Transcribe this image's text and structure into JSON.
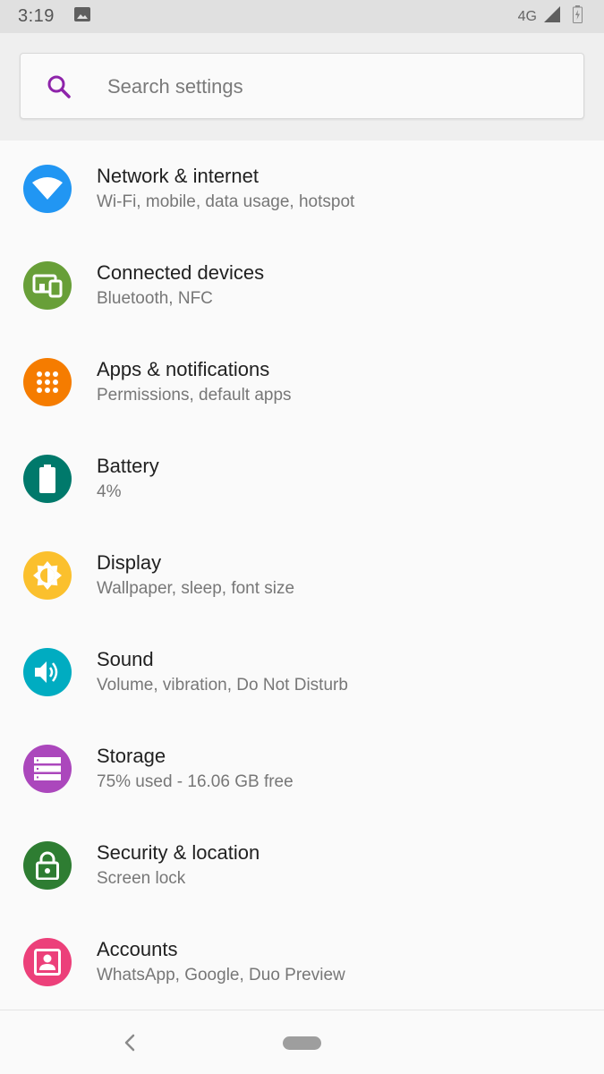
{
  "status_bar": {
    "time": "3:19",
    "network": "4G",
    "icons": [
      "image-icon",
      "signal-icon",
      "battery-icon"
    ]
  },
  "search": {
    "placeholder": "Search settings",
    "icon": "search-icon",
    "icon_color": "#8e24aa"
  },
  "settings": [
    {
      "title": "Network & internet",
      "subtitle": "Wi-Fi, mobile, data usage, hotspot",
      "icon": "wifi-icon",
      "color": "#2196f3"
    },
    {
      "title": "Connected devices",
      "subtitle": "Bluetooth, NFC",
      "icon": "devices-icon",
      "color": "#689f38"
    },
    {
      "title": "Apps & notifications",
      "subtitle": "Permissions, default apps",
      "icon": "apps-icon",
      "color": "#f57c00"
    },
    {
      "title": "Battery",
      "subtitle": "4%",
      "icon": "battery-icon",
      "color": "#00796b"
    },
    {
      "title": "Display",
      "subtitle": "Wallpaper, sleep, font size",
      "icon": "brightness-icon",
      "color": "#fbc02d"
    },
    {
      "title": "Sound",
      "subtitle": "Volume, vibration, Do Not Disturb",
      "icon": "volume-icon",
      "color": "#00acc1"
    },
    {
      "title": "Storage",
      "subtitle": "75% used - 16.06 GB free",
      "icon": "storage-icon",
      "color": "#ab47bc"
    },
    {
      "title": "Security & location",
      "subtitle": "Screen lock",
      "icon": "lock-icon",
      "color": "#2e7d32"
    },
    {
      "title": "Accounts",
      "subtitle": "WhatsApp, Google, Duo Preview",
      "icon": "account-icon",
      "color": "#ec407a"
    }
  ],
  "nav_bar": {
    "back_icon": "back-icon",
    "home_icon": "home-pill-icon"
  }
}
